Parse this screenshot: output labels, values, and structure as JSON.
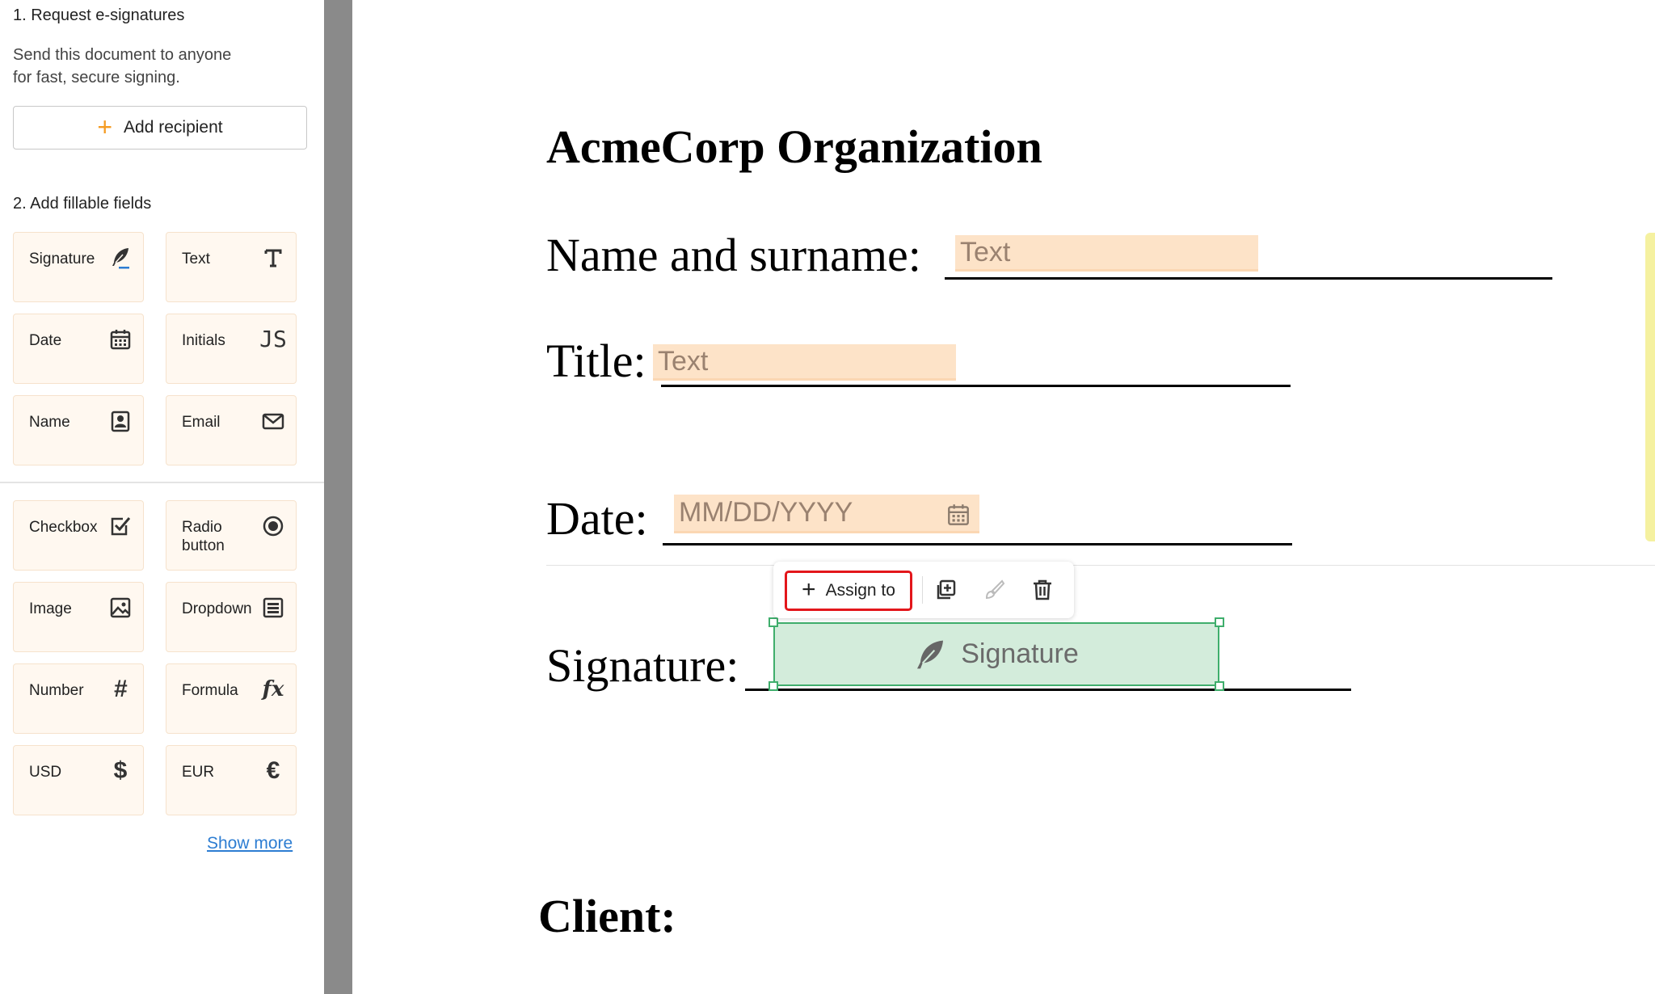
{
  "sidebar": {
    "section1_title": "1. Request e-signatures",
    "section1_desc_line1": "Send this document to anyone",
    "section1_desc_line2": "for fast, secure signing.",
    "add_recipient": {
      "plus": "+",
      "label": "Add recipient"
    },
    "section2_title": "2. Add fillable fields",
    "fields": [
      {
        "label": "Signature",
        "icon": "quill-icon"
      },
      {
        "label": "Text",
        "icon": "text-icon"
      },
      {
        "label": "Date",
        "icon": "calendar-icon"
      },
      {
        "label": "Initials",
        "icon": "initials-icon",
        "glyph": "JS"
      },
      {
        "label": "Name",
        "icon": "contact-card-icon"
      },
      {
        "label": "Email",
        "icon": "envelope-icon"
      },
      {
        "label": "Checkbox",
        "icon": "checkbox-icon"
      },
      {
        "label": "Radio\nbutton",
        "icon": "radio-icon"
      },
      {
        "label": "Image",
        "icon": "image-icon"
      },
      {
        "label": "Dropdown",
        "icon": "dropdown-list-icon"
      },
      {
        "label": "Number",
        "icon": "hash-icon",
        "glyph": "#"
      },
      {
        "label": "Formula",
        "icon": "function-icon",
        "glyph": "fx"
      },
      {
        "label": "USD",
        "icon": "dollar-icon",
        "glyph": "$"
      },
      {
        "label": "EUR",
        "icon": "euro-icon",
        "glyph": "€"
      }
    ],
    "show_more": "Show more"
  },
  "document": {
    "title": "AcmeCorp Organization",
    "name_label": "Name and surname:",
    "name_placeholder": "Text",
    "title_label": "Title:",
    "title_placeholder": "Text",
    "date_label": "Date:",
    "date_placeholder": "MM/DD/YYYY",
    "signature_label": "Signature:",
    "signature_placeholder": "Signature",
    "client_label": "Client:"
  },
  "toolbar": {
    "assign_plus": "+",
    "assign_label": "Assign to"
  },
  "colors": {
    "accent_orange": "#f59b22",
    "field_bg": "#fff8f0",
    "input_bg": "#fde3c8",
    "signature_bg": "#d3ecdb",
    "selection_green": "#3fae6c",
    "highlight_red": "#e3161b",
    "link_blue": "#2d7dd2"
  }
}
